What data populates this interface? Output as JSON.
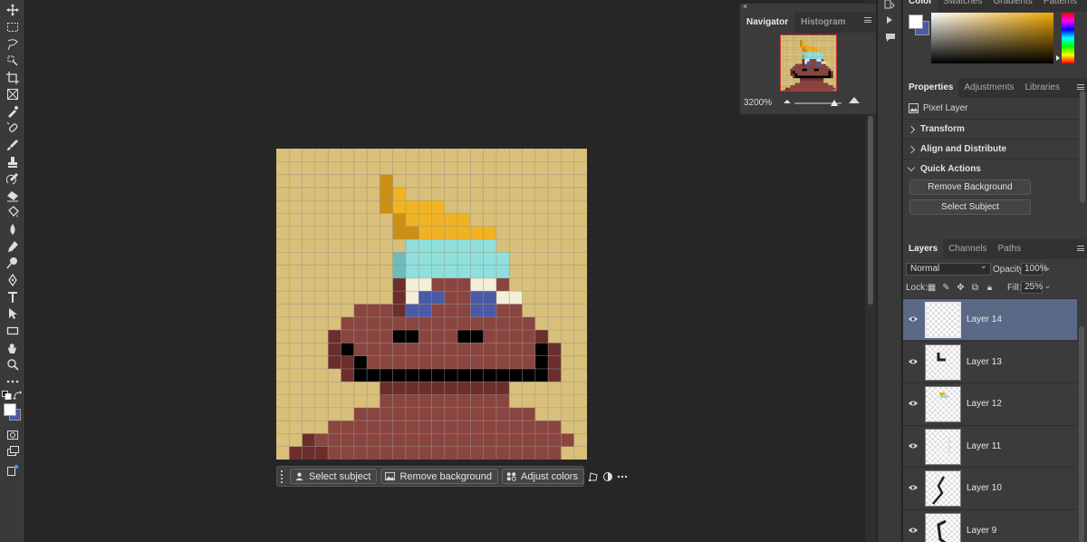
{
  "navigator": {
    "tabs": [
      "Navigator",
      "Histogram"
    ],
    "zoom": "3200%"
  },
  "color_panel": {
    "tabs": [
      "Color",
      "Swatches",
      "Gradients",
      "Patterns"
    ],
    "foreground": "#ffffff",
    "background": "#4a5aa6",
    "hue_base": "#f0a800"
  },
  "properties": {
    "tabs": [
      "Properties",
      "Adjustments",
      "Libraries"
    ],
    "layer_type": "Pixel Layer",
    "sections": [
      "Transform",
      "Align and Distribute",
      "Quick Actions"
    ],
    "quick_actions": [
      "Remove Background",
      "Select Subject"
    ]
  },
  "layers_panel": {
    "tabs": [
      "Layers",
      "Channels",
      "Paths"
    ],
    "blend_mode": "Normal",
    "opacity_label": "Opacity:",
    "opacity": "100%",
    "lock_label": "Lock:",
    "fill_label": "Fill:",
    "fill": "25%",
    "layers": [
      {
        "name": "Layer 14",
        "selected": true
      },
      {
        "name": "Layer 13",
        "selected": false
      },
      {
        "name": "Layer 12",
        "selected": false
      },
      {
        "name": "Layer 11",
        "selected": false
      },
      {
        "name": "Layer 10",
        "selected": false
      },
      {
        "name": "Layer 9",
        "selected": false
      }
    ]
  },
  "taskbar": {
    "select_subject": "Select subject",
    "remove_background": "Remove background",
    "adjust_colors": "Adjust colors"
  },
  "tools": [
    "move-icon",
    "marquee-icon",
    "lasso-icon",
    "object-select-icon",
    "crop-icon",
    "frame-icon",
    "eyedropper-icon",
    "healing-brush-icon",
    "brush-icon",
    "clone-stamp-icon",
    "history-brush-icon",
    "eraser-icon",
    "paint-bucket-icon",
    "blur-icon",
    "smudge-icon",
    "dodge-icon",
    "pen-icon",
    "type-icon",
    "path-select-icon",
    "rectangle-icon",
    "hand-icon",
    "zoom-icon",
    "more-tools-icon"
  ],
  "artwork": {
    "colors": {
      "background": "#d8c07a",
      "skin": "#8a4540",
      "skin_dark": "#6b2e2c",
      "hair_dark": "#cc8f12",
      "hair": "#f0b323",
      "beanie": "#8ee0dd",
      "beanie_shade": "#6cbcbc",
      "eye_white": "#f3efd9",
      "eye": "#4a5aa6",
      "mouth": "#000000",
      "grid": "#9f9585"
    }
  }
}
